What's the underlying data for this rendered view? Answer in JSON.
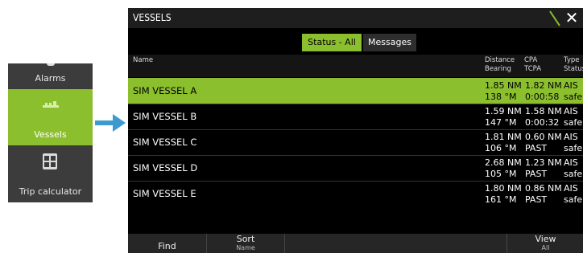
{
  "menu": {
    "items": [
      {
        "label": "Alarms",
        "selected": false,
        "icon": "bell-icon"
      },
      {
        "label": "Vessels",
        "selected": true,
        "icon": "vessels-icon"
      },
      {
        "label": "Trip calculator",
        "selected": false,
        "icon": "calculator-icon"
      }
    ]
  },
  "window": {
    "title": "VESSELS",
    "tabs": [
      {
        "label": "Status - All",
        "selected": true
      },
      {
        "label": "Messages",
        "selected": false
      }
    ]
  },
  "table": {
    "headers": {
      "name": "Name",
      "distance": "Distance",
      "bearing": "Bearing",
      "cpa": "CPA",
      "tcpa": "TCPA",
      "type": "Type",
      "status": "Status"
    },
    "rows": [
      {
        "name": "SIM VESSEL A",
        "distance": "1.85 NM",
        "bearing": "138 °M",
        "cpa": "1.82 NM",
        "tcpa": "0:00:58",
        "type": "AIS",
        "status": "safe",
        "selected": true
      },
      {
        "name": "SIM VESSEL B",
        "distance": "1.59 NM",
        "bearing": "147 °M",
        "cpa": "1.58 NM",
        "tcpa": "0:00:32",
        "type": "AIS",
        "status": "safe",
        "selected": false
      },
      {
        "name": "SIM VESSEL C",
        "distance": "1.81 NM",
        "bearing": "106 °M",
        "cpa": "0.60 NM",
        "tcpa": "PAST",
        "type": "AIS",
        "status": "safe",
        "selected": false
      },
      {
        "name": "SIM VESSEL D",
        "distance": "2.68 NM",
        "bearing": "105 °M",
        "cpa": "1.23 NM",
        "tcpa": "PAST",
        "type": "AIS",
        "status": "safe",
        "selected": false
      },
      {
        "name": "SIM VESSEL E",
        "distance": "1.80 NM",
        "bearing": "161 °M",
        "cpa": "0.86 NM",
        "tcpa": "PAST",
        "type": "AIS",
        "status": "safe",
        "selected": false
      }
    ]
  },
  "bottom_bar": {
    "find": "Find",
    "sort": {
      "label": "Sort",
      "value": "Name"
    },
    "view": {
      "label": "View",
      "value": "All"
    }
  },
  "colors": {
    "accent": "#8cbf2e",
    "background": "#000000"
  }
}
